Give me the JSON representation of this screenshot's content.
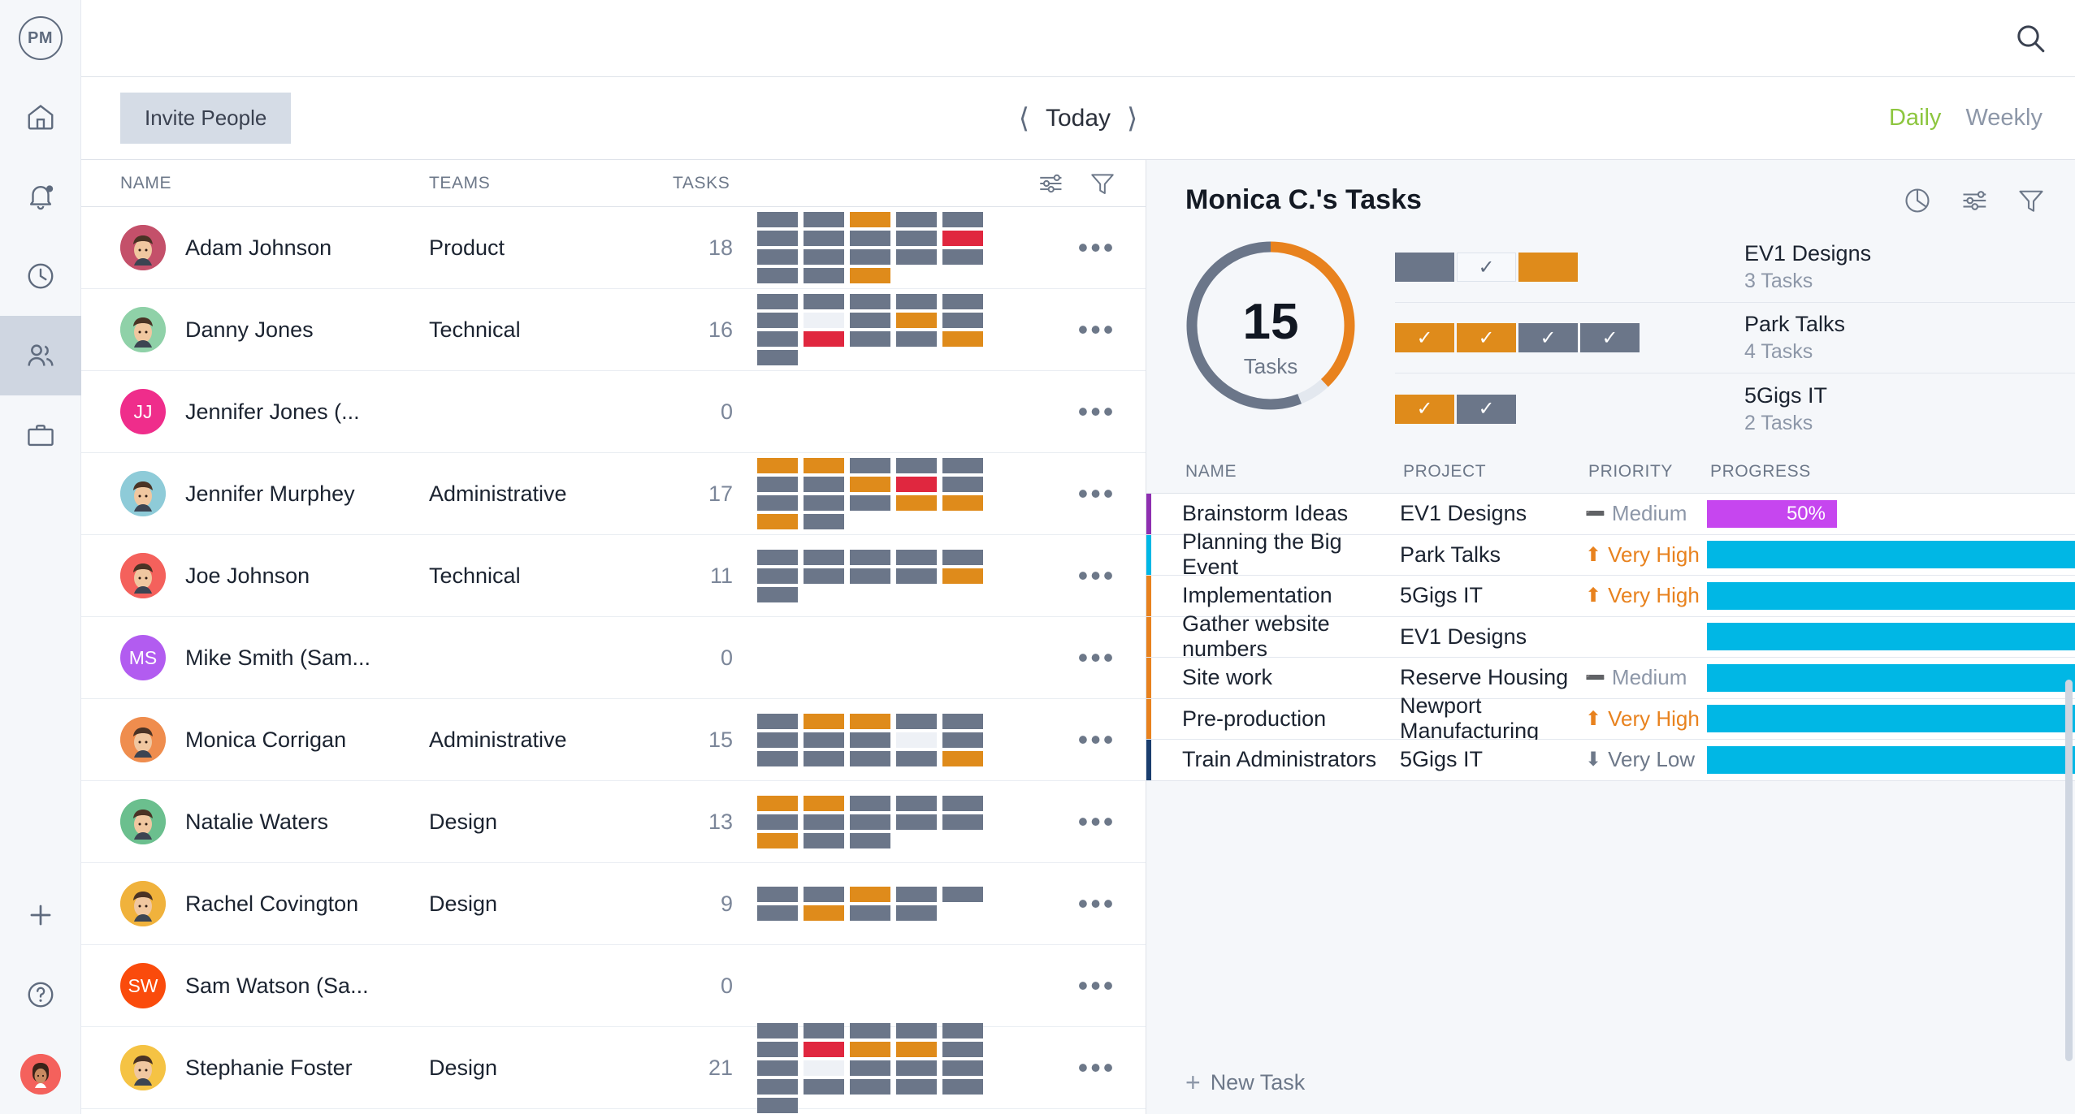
{
  "app": {
    "logo_text": "PM",
    "search_icon": "search-icon"
  },
  "toolbar": {
    "invite_label": "Invite People",
    "prev_icon": "chevron-left-icon",
    "next_icon": "chevron-right-icon",
    "today_label": "Today",
    "daily_label": "Daily",
    "weekly_label": "Weekly",
    "daily_color": "#8dc63f",
    "weekly_color": "#8d97a8"
  },
  "rail": {
    "items": [
      {
        "icon": "home-icon",
        "active": false
      },
      {
        "icon": "bell-icon",
        "active": false
      },
      {
        "icon": "clock-icon",
        "active": false
      },
      {
        "icon": "people-icon",
        "active": true
      },
      {
        "icon": "briefcase-icon",
        "active": false
      }
    ],
    "bottom": [
      {
        "icon": "plus-icon"
      },
      {
        "icon": "help-circle-icon"
      },
      {
        "icon": "user-avatar-icon"
      }
    ]
  },
  "people_table": {
    "columns": [
      "NAME",
      "TEAMS",
      "TASKS"
    ],
    "header_icons": [
      "sliders-icon",
      "funnel-icon"
    ],
    "row_menu_icon": "more-horizontal-icon",
    "rows": [
      {
        "name": "Adam Johnson",
        "team": "Product",
        "count": "18",
        "initials": "",
        "avatar_color": "#c4506a",
        "avatar_type": "photo",
        "blocks": [
          "g",
          "g",
          "o",
          "g",
          "g",
          "g",
          "g",
          "g",
          "g",
          "r",
          "g",
          "g",
          "g",
          "g",
          "g",
          "g",
          "g",
          "o"
        ]
      },
      {
        "name": "Danny Jones",
        "team": "Technical",
        "count": "16",
        "initials": "",
        "avatar_color": "#8fd1a8",
        "avatar_type": "photo",
        "blocks": [
          "g",
          "g",
          "g",
          "g",
          "g",
          "g",
          "e",
          "g",
          "o",
          "g",
          "g",
          "r",
          "g",
          "g",
          "o",
          "g"
        ]
      },
      {
        "name": "Jennifer Jones (...",
        "team": "",
        "count": "0",
        "initials": "JJ",
        "avatar_color": "#ef2d8b",
        "avatar_type": "initials",
        "blocks": []
      },
      {
        "name": "Jennifer Murphey",
        "team": "Administrative",
        "count": "17",
        "initials": "",
        "avatar_color": "#8ecbd8",
        "avatar_type": "photo",
        "blocks": [
          "o",
          "o",
          "g",
          "g",
          "g",
          "g",
          "g",
          "o",
          "r",
          "g",
          "g",
          "g",
          "g",
          "o",
          "o",
          "o",
          "g"
        ]
      },
      {
        "name": "Joe Johnson",
        "team": "Technical",
        "count": "11",
        "initials": "",
        "avatar_color": "#f4615c",
        "avatar_type": "photo",
        "blocks": [
          "g",
          "g",
          "g",
          "g",
          "g",
          "g",
          "g",
          "g",
          "g",
          "o",
          "g"
        ]
      },
      {
        "name": "Mike Smith (Sam...",
        "team": "",
        "count": "0",
        "initials": "MS",
        "avatar_color": "#b25cf0",
        "avatar_type": "initials",
        "blocks": []
      },
      {
        "name": "Monica Corrigan",
        "team": "Administrative",
        "count": "15",
        "initials": "",
        "avatar_color": "#ef8d4e",
        "avatar_type": "photo",
        "blocks": [
          "g",
          "o",
          "o",
          "g",
          "g",
          "g",
          "g",
          "g",
          "e",
          "g",
          "g",
          "g",
          "g",
          "g",
          "o"
        ]
      },
      {
        "name": "Natalie Waters",
        "team": "Design",
        "count": "13",
        "initials": "",
        "avatar_color": "#6bbf8e",
        "avatar_type": "photo",
        "blocks": [
          "o",
          "o",
          "g",
          "g",
          "g",
          "g",
          "g",
          "g",
          "g",
          "g",
          "o",
          "g",
          "g"
        ]
      },
      {
        "name": "Rachel Covington",
        "team": "Design",
        "count": "9",
        "initials": "",
        "avatar_color": "#f0b23c",
        "avatar_type": "photo",
        "blocks": [
          "g",
          "g",
          "o",
          "g",
          "g",
          "g",
          "o",
          "g",
          "g"
        ]
      },
      {
        "name": "Sam Watson (Sa...",
        "team": "",
        "count": "0",
        "initials": "SW",
        "avatar_color": "#fa4b0c",
        "avatar_type": "initials",
        "blocks": []
      },
      {
        "name": "Stephanie Foster",
        "team": "Design",
        "count": "21",
        "initials": "",
        "avatar_color": "#f5c344",
        "avatar_type": "photo",
        "blocks": [
          "g",
          "g",
          "g",
          "g",
          "g",
          "g",
          "r",
          "o",
          "o",
          "g",
          "g",
          "e",
          "g",
          "g",
          "g",
          "g",
          "g",
          "g",
          "g",
          "g",
          "g"
        ]
      }
    ]
  },
  "task_panel": {
    "title": "Monica C.'s Tasks",
    "header_icons": [
      "pie-chart-icon",
      "sliders-icon",
      "funnel-icon"
    ],
    "donut": {
      "value": "15",
      "caption": "Tasks",
      "orange_pct": 38,
      "grey_pct": 56,
      "light_pct": 6,
      "orange_color": "#e8821e",
      "grey_color": "#6b7689",
      "light_color": "#e3e8ef"
    },
    "projects": [
      {
        "name": "EV1 Designs",
        "tasks_label": "3 Tasks",
        "chips": [
          {
            "style": "g",
            "check": false
          },
          {
            "style": "e",
            "check": true
          },
          {
            "style": "o",
            "check": false
          }
        ]
      },
      {
        "name": "Park Talks",
        "tasks_label": "4 Tasks",
        "chips": [
          {
            "style": "o",
            "check": true
          },
          {
            "style": "o",
            "check": true
          },
          {
            "style": "g",
            "check": true
          },
          {
            "style": "g",
            "check": true
          }
        ]
      },
      {
        "name": "5Gigs IT",
        "tasks_label": "2 Tasks",
        "chips": [
          {
            "style": "o",
            "check": true
          },
          {
            "style": "g",
            "check": true
          }
        ]
      }
    ],
    "task_table": {
      "columns": [
        "NAME",
        "PROJECT",
        "PRIORITY",
        "PROGRESS"
      ],
      "rows": [
        {
          "name": "Brainstorm Ideas",
          "project": "EV1 Designs",
          "priority": "Medium",
          "priority_kind": "medium",
          "progress_label": "50%",
          "progress_pct": 50,
          "bar_color": "#c646ef",
          "stripe_color": "#8e2fb0"
        },
        {
          "name": "Planning the Big Event",
          "project": "Park Talks",
          "priority": "Very High",
          "priority_kind": "high",
          "progress_label": "",
          "progress_pct": 100,
          "bar_color": "#00b7e5",
          "stripe_color": "#00b7e5"
        },
        {
          "name": "Implementation",
          "project": "5Gigs IT",
          "priority": "Very High",
          "priority_kind": "high",
          "progress_label": "",
          "progress_pct": 100,
          "bar_color": "#00b7e5",
          "stripe_color": "#e8821e"
        },
        {
          "name": "Gather website numbers",
          "project": "EV1 Designs",
          "priority": "",
          "priority_kind": "none",
          "progress_label": "",
          "progress_pct": 100,
          "bar_color": "#00b7e5",
          "stripe_color": "#e8821e"
        },
        {
          "name": "Site work",
          "project": "Reserve Housing",
          "priority": "Medium",
          "priority_kind": "medium",
          "progress_label": "",
          "progress_pct": 100,
          "bar_color": "#00b7e5",
          "stripe_color": "#e8821e"
        },
        {
          "name": "Pre-production",
          "project": "Newport Manufacturing",
          "priority": "Very High",
          "priority_kind": "high",
          "progress_label": "",
          "progress_pct": 100,
          "bar_color": "#00b7e5",
          "stripe_color": "#e8821e"
        },
        {
          "name": "Train Administrators",
          "project": "5Gigs IT",
          "priority": "Very Low",
          "priority_kind": "low",
          "progress_label": "",
          "progress_pct": 100,
          "bar_color": "#00b7e5",
          "stripe_color": "#1a3e6e"
        }
      ],
      "new_task_label": "New Task",
      "new_task_icon": "plus-icon"
    }
  }
}
